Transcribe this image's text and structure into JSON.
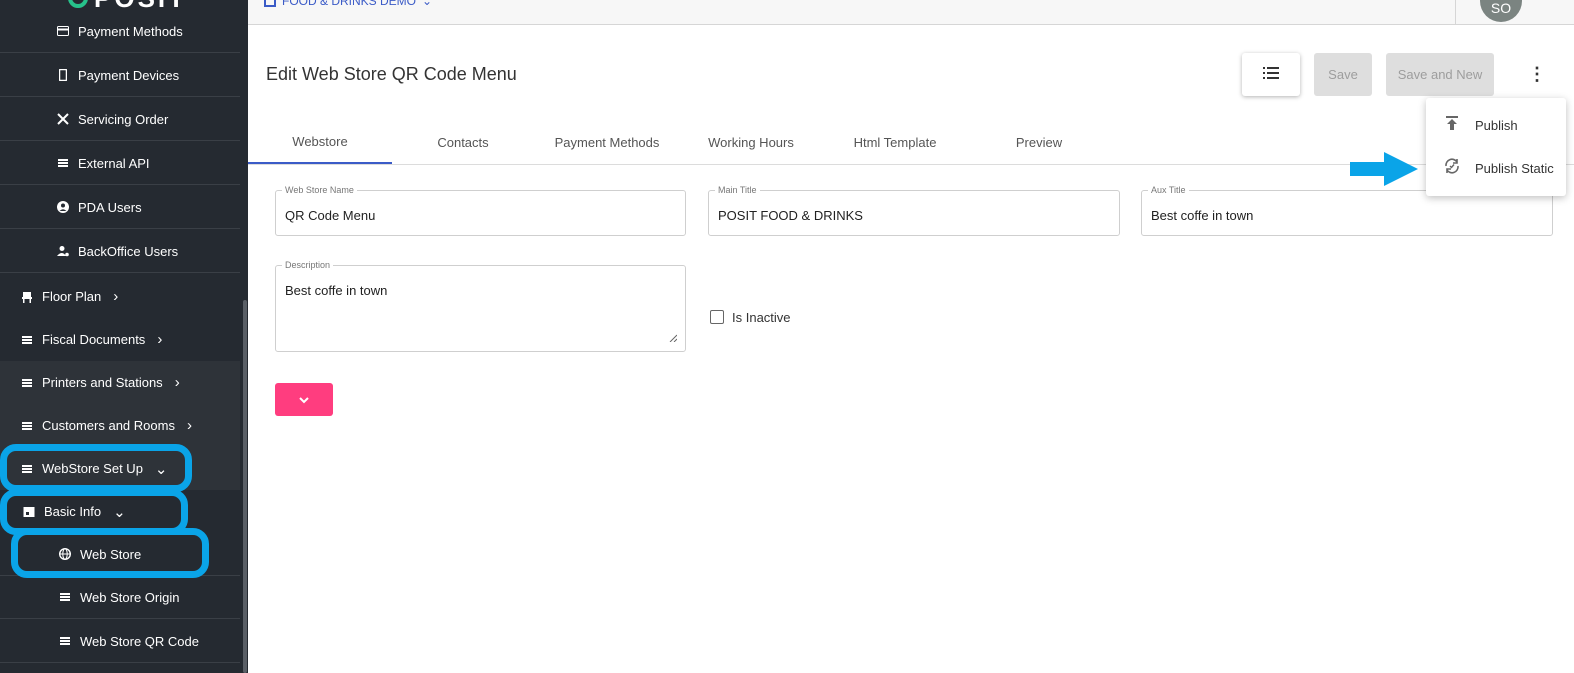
{
  "app": {
    "logo_text": "POSIT",
    "org_selector": "FOOD & DRINKS DEMO",
    "user_initials": "SO"
  },
  "sidebar": {
    "items": [
      {
        "label": "Payment Methods",
        "icon": "card-icon"
      },
      {
        "label": "Payment Devices",
        "icon": "phone-icon"
      },
      {
        "label": "Servicing Order",
        "icon": "utensils-icon"
      },
      {
        "label": "External API",
        "icon": "list-icon"
      },
      {
        "label": "PDA Users",
        "icon": "user-circle-icon"
      },
      {
        "label": "BackOffice Users",
        "icon": "user-gear-icon"
      },
      {
        "label": "Floor Plan",
        "icon": "chair-icon"
      },
      {
        "label": "Fiscal Documents",
        "icon": "list-icon"
      },
      {
        "label": "Printers and Stations",
        "icon": "list-icon"
      },
      {
        "label": "Customers and Rooms",
        "icon": "list-icon"
      },
      {
        "label": "WebStore Set Up",
        "icon": "list-icon"
      },
      {
        "label": "Basic Info",
        "icon": "store-icon"
      },
      {
        "label": "Web Store",
        "icon": "globe-icon"
      },
      {
        "label": "Web Store Origin",
        "icon": "list-icon"
      },
      {
        "label": "Web Store QR Code",
        "icon": "list-icon"
      }
    ]
  },
  "page": {
    "title": "Edit Web Store QR Code Menu"
  },
  "toolbar": {
    "save_label": "Save",
    "save_new_label": "Save and New",
    "more_glyph": "⋮",
    "list_glyph": "☰"
  },
  "tabs": [
    "Webstore",
    "Contacts",
    "Payment Methods",
    "Working Hours",
    "Html Template",
    "Preview"
  ],
  "form": {
    "web_store_name": {
      "label": "Web Store Name",
      "value": "QR Code Menu"
    },
    "main_title": {
      "label": "Main Title",
      "value": "POSIT FOOD & DRINKS"
    },
    "aux_title": {
      "label": "Aux Title",
      "value": "Best coffe in town"
    },
    "description": {
      "label": "Description",
      "value": "Best coffe in town"
    },
    "is_inactive_label": "Is Inactive",
    "is_inactive": false
  },
  "menu": {
    "items": [
      {
        "label": "Publish",
        "icon": "upload-icon"
      },
      {
        "label": "Publish Static",
        "icon": "sync-icon"
      }
    ]
  },
  "colors": {
    "sidebar_bg": "#252a31",
    "accent": "#3b5bc7",
    "highlight": "#0aa4e8",
    "expand_button": "#ff3d7f"
  }
}
